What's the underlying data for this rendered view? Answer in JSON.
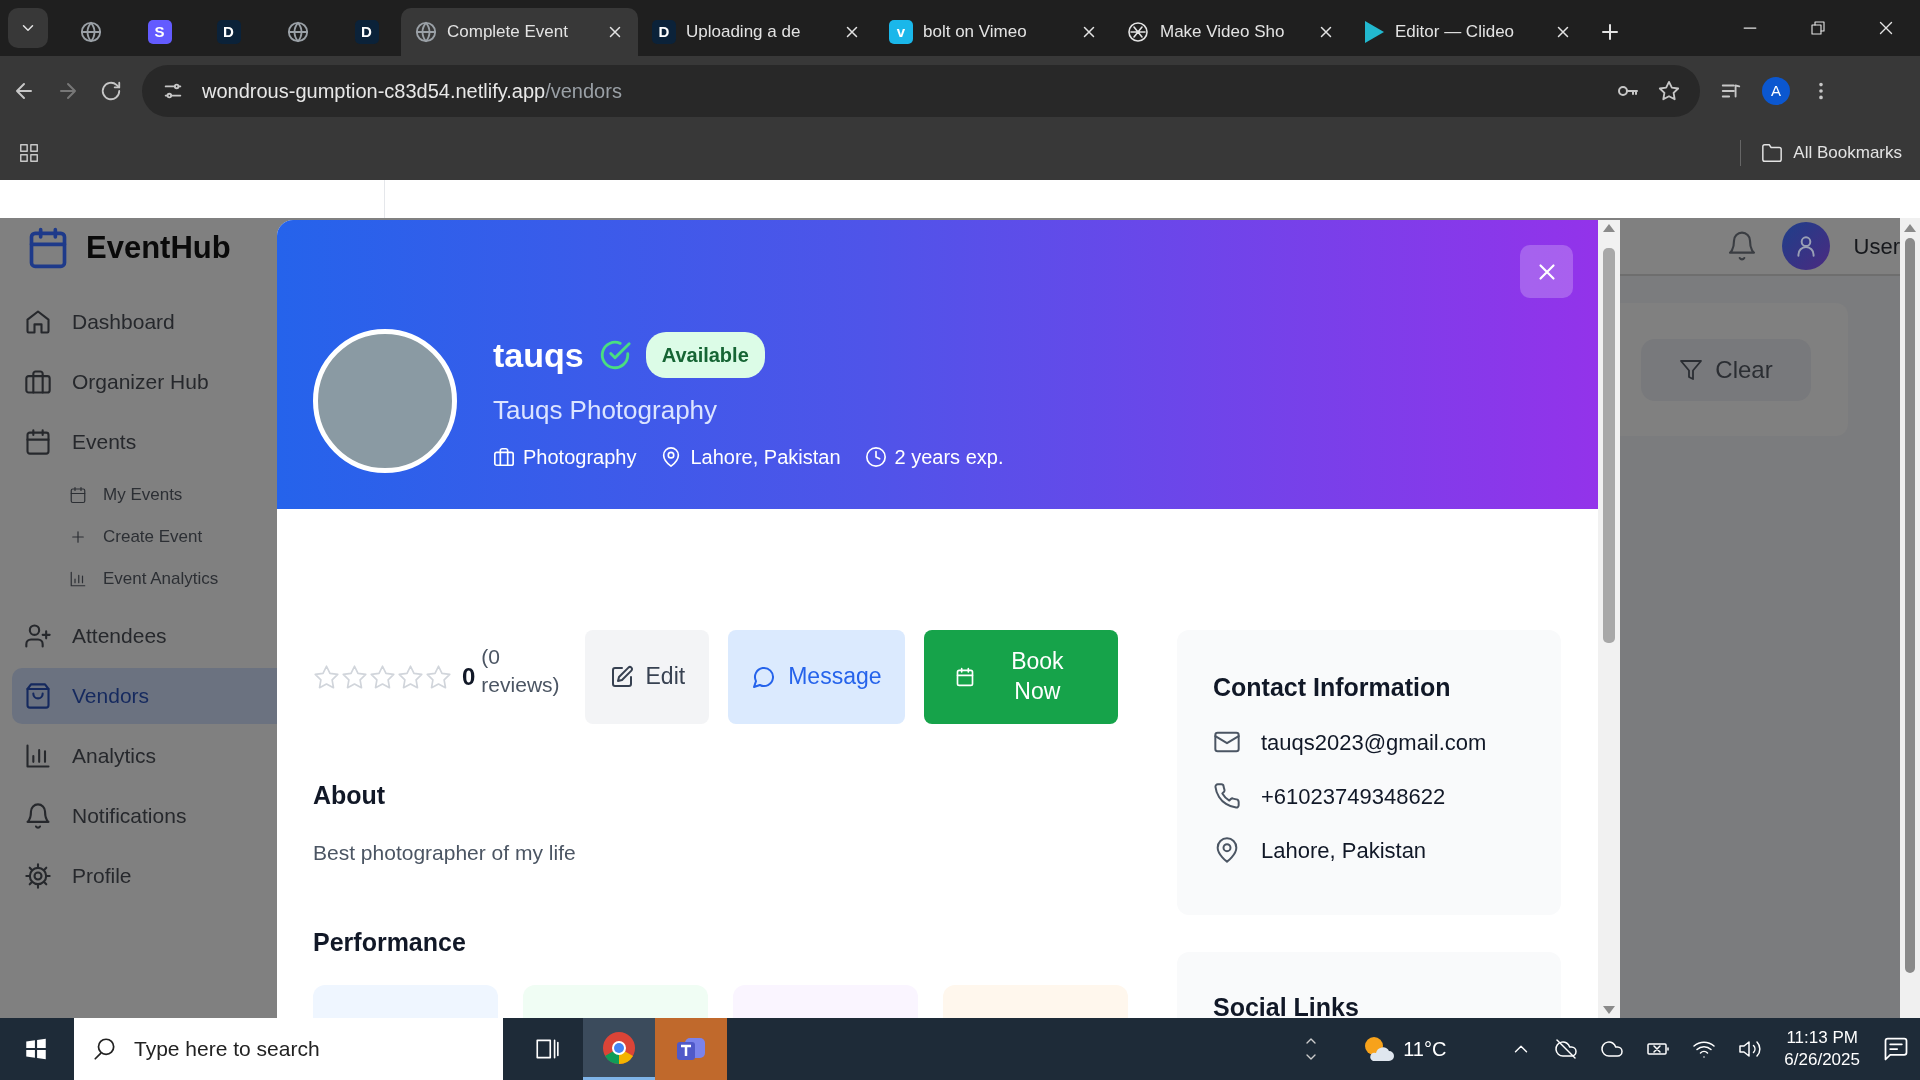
{
  "browser": {
    "tabs": [
      {
        "kind": "globe",
        "selected": false
      },
      {
        "kind": "letter",
        "letter": "S",
        "color": "#635bff",
        "selected": false
      },
      {
        "kind": "letter",
        "letter": "D",
        "color": "#0b2239",
        "selected": false
      },
      {
        "kind": "globe",
        "selected": false
      },
      {
        "kind": "letter",
        "letter": "D",
        "color": "#0b2239",
        "selected": false
      },
      {
        "kind": "globe",
        "title": "Complete Event",
        "selected": true
      },
      {
        "kind": "letter",
        "letter": "D",
        "color": "#0b2239",
        "title": "Uploading a de",
        "selected": false
      },
      {
        "kind": "letter",
        "letter": "v",
        "color": "#1ab7ea",
        "title": "bolt on Vimeo",
        "selected": false
      },
      {
        "kind": "knot",
        "title": "Make Video Sho",
        "selected": false
      },
      {
        "kind": "play",
        "color": "#22b8cf",
        "title": "Editor — Clideo",
        "selected": false
      }
    ],
    "url": {
      "host": "wondrous-gumption-c83d54.netlify.app",
      "path": "/vendors"
    },
    "profile_initial": "A",
    "bookmarks_label": "All Bookmarks"
  },
  "app": {
    "brand": "EventHub",
    "sidebar": {
      "items": [
        {
          "label": "Dashboard",
          "selected": false
        },
        {
          "label": "Organizer Hub",
          "selected": false
        },
        {
          "label": "Events",
          "selected": false,
          "children": [
            {
              "label": "My Events",
              "selected": false
            },
            {
              "label": "Create Event",
              "selected": false
            },
            {
              "label": "Event Analytics",
              "selected": false
            }
          ]
        },
        {
          "label": "Attendees",
          "selected": false
        },
        {
          "label": "Vendors",
          "selected": true
        },
        {
          "label": "Analytics",
          "selected": false
        },
        {
          "label": "Notifications",
          "selected": false
        },
        {
          "label": "Profile",
          "selected": false
        }
      ]
    },
    "header": {
      "user": "User"
    },
    "filters": {
      "clear_label": "Clear"
    }
  },
  "modal": {
    "profile": {
      "name": "tauqs",
      "verified": true,
      "status": "Available",
      "business": "Tauqs Photography",
      "meta": [
        {
          "kind": "category",
          "text": "Photography"
        },
        {
          "kind": "location",
          "text": "Lahore, Pakistan"
        },
        {
          "kind": "experience",
          "text": "2 years exp."
        }
      ]
    },
    "rating": {
      "stars": 0,
      "score": "0",
      "reviews": "(0 reviews)"
    },
    "actions": [
      {
        "kind": "edit",
        "label": "Edit"
      },
      {
        "kind": "message",
        "label": "Message"
      },
      {
        "kind": "book",
        "label": "Book Now"
      }
    ],
    "about": {
      "title": "About",
      "text": "Best photographer of my life"
    },
    "performance": {
      "title": "Performance",
      "cards": [
        {
          "color": "#eff6ff"
        },
        {
          "color": "#f0fdf4"
        },
        {
          "color": "#faf5ff"
        },
        {
          "color": "#fff7ed"
        }
      ]
    },
    "contact": {
      "title": "Contact Information",
      "items": [
        {
          "kind": "email",
          "text": "tauqs2023@gmail.com"
        },
        {
          "kind": "phone",
          "text": "+61023749348622"
        },
        {
          "kind": "location",
          "text": "Lahore, Pakistan"
        }
      ]
    },
    "social": {
      "title": "Social Links"
    }
  },
  "taskbar": {
    "search": {
      "placeholder": "Type here to search"
    },
    "apps": [
      {
        "kind": "chrome",
        "selected": true,
        "flashing": false
      },
      {
        "kind": "teams",
        "selected": false,
        "flashing": true
      }
    ],
    "weather": "11°C",
    "time": "11:13 PM",
    "date": "6/26/2025"
  }
}
